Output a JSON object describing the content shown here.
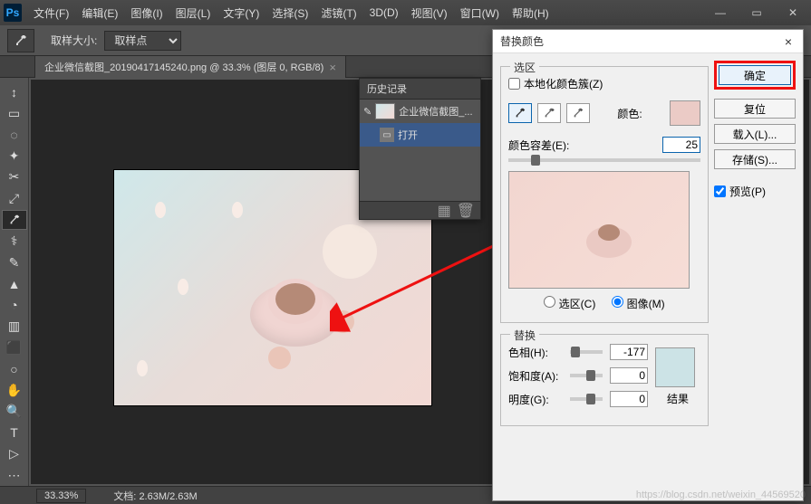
{
  "app": {
    "logo": "Ps"
  },
  "menu": [
    "文件(F)",
    "编辑(E)",
    "图像(I)",
    "图层(L)",
    "文字(Y)",
    "选择(S)",
    "滤镜(T)",
    "3D(D)",
    "视图(V)",
    "窗口(W)",
    "帮助(H)"
  ],
  "window_controls": {
    "min": "—",
    "max": "▭",
    "close": "✕"
  },
  "options": {
    "sample_size_label": "取样大小:",
    "sample_size_value": "取样点"
  },
  "doc_tab": {
    "title": "企业微信截图_20190417145240.png @ 33.3% (图层 0, RGB/8)",
    "close": "×"
  },
  "tools": [
    "↕",
    "▭",
    "◌",
    "✦",
    "✂",
    "⤢",
    "◉",
    "⚕",
    "✎",
    "▲",
    "◔",
    "▥",
    "⬛",
    "○",
    "✋",
    "🔍",
    "T",
    "▷",
    "⋯"
  ],
  "status": {
    "zoom": "33.33%",
    "doc_label": "文档:",
    "doc_size": "2.63M/2.63M"
  },
  "history": {
    "title": "历史记录",
    "rows": [
      {
        "icon": "✎",
        "label": "企业微信截图_..."
      },
      {
        "icon": "▭",
        "label": "打开"
      }
    ],
    "foot_icons": [
      "▦",
      "🗑"
    ]
  },
  "dialog": {
    "title": "替换颜色",
    "close": "×",
    "buttons": {
      "ok": "确定",
      "reset": "复位",
      "load": "载入(L)...",
      "save": "存储(S)..."
    },
    "preview_chk": "预览(P)",
    "section_selection": "选区",
    "localized_chk": "本地化颜色簇(Z)",
    "color_label": "颜色:",
    "color_swatch": "#ebcbc6",
    "fuzziness_label": "颜色容差(E):",
    "fuzziness_value": "25",
    "radio_selection": "选区(C)",
    "radio_image": "图像(M)",
    "section_replace": "替换",
    "hue_label": "色相(H):",
    "hue_value": "-177",
    "sat_label": "饱和度(A):",
    "sat_value": "0",
    "light_label": "明度(G):",
    "light_value": "0",
    "result_label": "结果",
    "result_swatch": "#cce3e6"
  },
  "watermark": "https://blog.csdn.net/weixin_44569520"
}
